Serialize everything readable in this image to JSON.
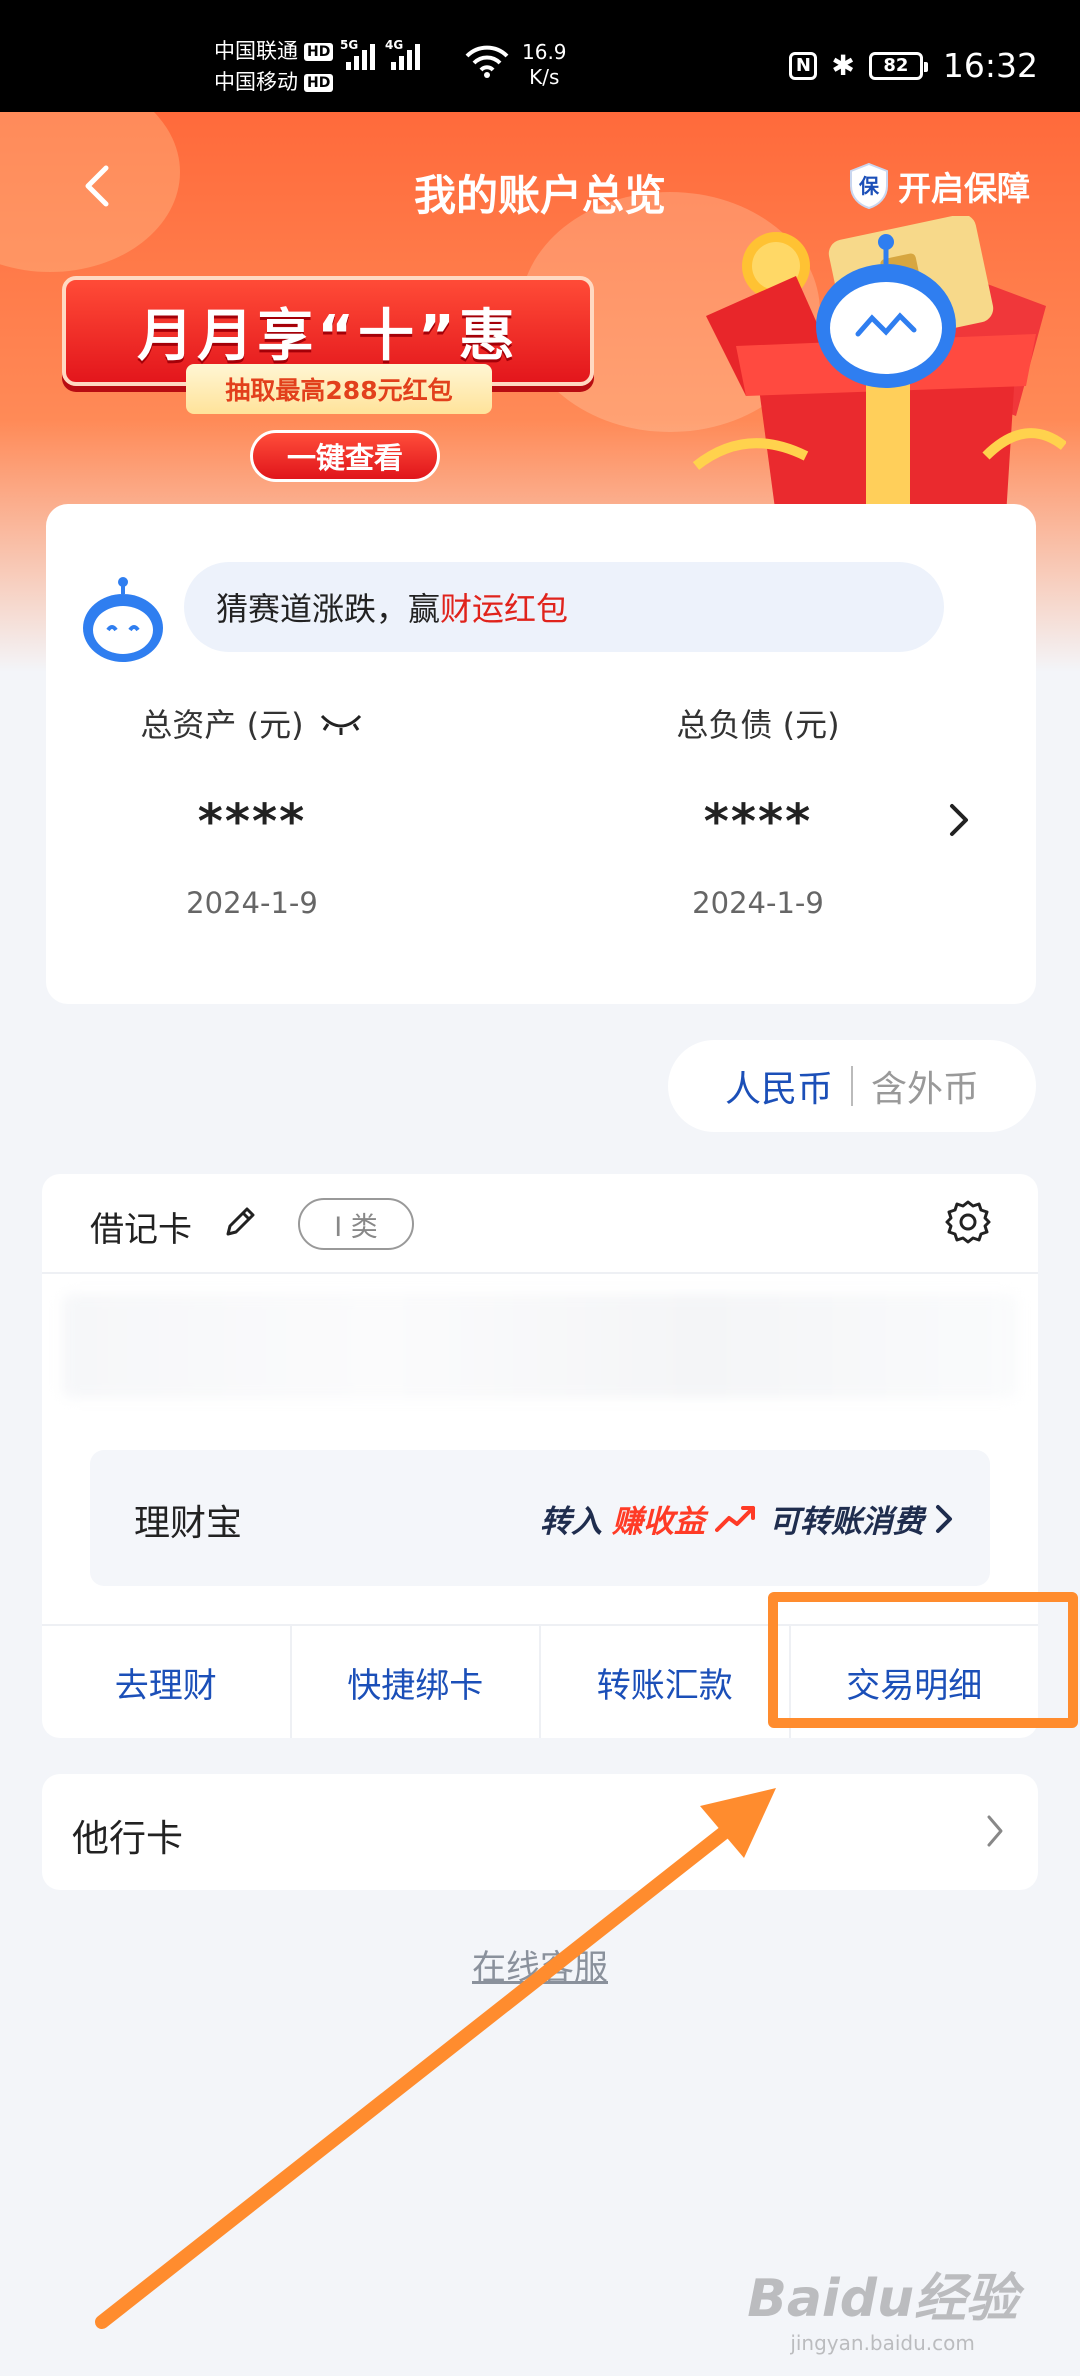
{
  "status_bar": {
    "carrier_1": "中国联通",
    "carrier_2": "中国移动",
    "hd_badge": "HD",
    "net_5g": "5G",
    "net_4g": "4G",
    "speed_value": "16.9",
    "speed_unit": "K/s",
    "battery": "82",
    "time": "16:32"
  },
  "header": {
    "title": "我的账户总览",
    "guarantee_badge": "保",
    "guarantee_label": "开启保障"
  },
  "promo": {
    "title": "月月享“十”惠",
    "subtitle": "抽取最高288元红包",
    "button": "一键查看"
  },
  "assets": {
    "tip_text": "猜赛道涨跌，赢",
    "tip_highlight": "财运红包",
    "total_assets_label": "总资产 (元)",
    "total_assets_value": "****",
    "total_assets_date": "2024-1-9",
    "total_debt_label": "总负债 (元)",
    "total_debt_value": "****",
    "total_debt_date": "2024-1-9"
  },
  "currency": {
    "active": "人民币",
    "inactive": "含外币"
  },
  "debit_card": {
    "title": "借记卡",
    "class_badge": "I 类",
    "licaibao": {
      "name": "理财宝",
      "promo_prefix": "转入",
      "promo_highlight": "赚收益",
      "promo_suffix": "可转账消费"
    },
    "actions": [
      "去理财",
      "快捷绑卡",
      "转账汇款",
      "交易明细"
    ]
  },
  "other_card": {
    "title": "他行卡"
  },
  "service_link": "在线客服",
  "watermark": {
    "main": "Baidu经验",
    "sub": "jingyan.baidu.com"
  },
  "colors": {
    "brand_orange": "#ff6a3b",
    "link_blue": "#1b4fb8",
    "highlight_red": "#e0231c",
    "annotation_orange": "#ff8c2e"
  }
}
